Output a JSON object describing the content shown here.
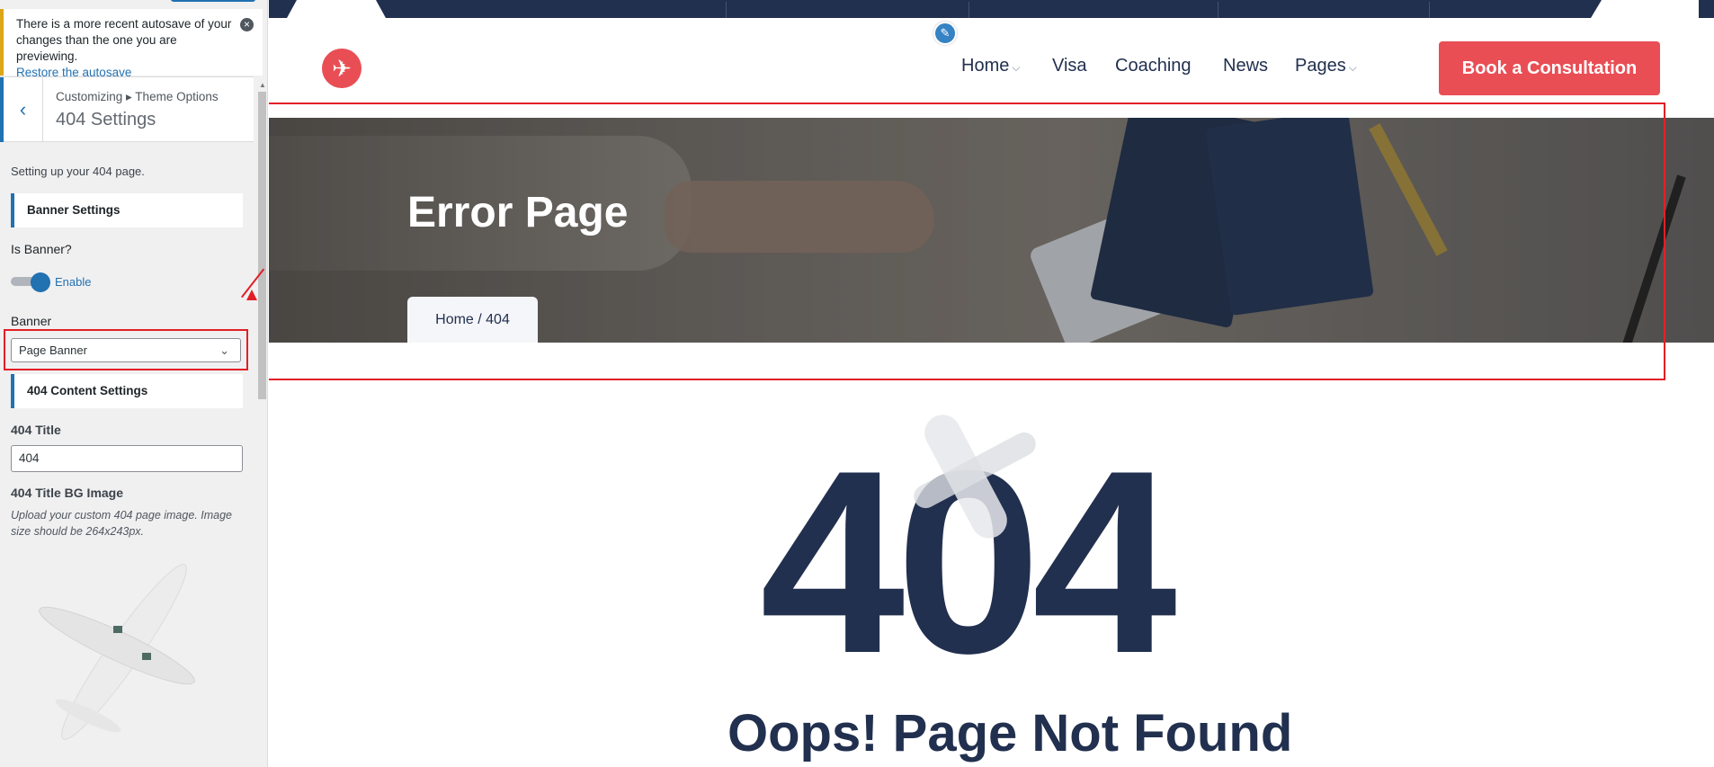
{
  "customizer": {
    "notice": {
      "line1": "There is a more recent autosave of your",
      "line2": "changes than the one you are previewing.",
      "link": "Restore the autosave",
      "close_icon": "close-circle-icon"
    },
    "breadcrumb": "Customizing ▸ Theme Options",
    "section_title": "404 Settings",
    "description": "Setting up your 404 page.",
    "banner_settings": {
      "heading": "Banner Settings",
      "is_banner_label": "Is Banner?",
      "toggle_label": "Enable",
      "toggle_state": "on",
      "banner_label": "Banner",
      "banner_value": "Page Banner"
    },
    "content_settings": {
      "heading": "404 Content Settings",
      "title_label": "404 Title",
      "title_value": "404",
      "bg_image_label": "404 Title BG Image",
      "bg_image_desc": "Upload your custom 404 page image. Image size should be 264x243px."
    }
  },
  "preview": {
    "nav": [
      {
        "label": "Home",
        "has_dropdown": true
      },
      {
        "label": "Visa",
        "has_dropdown": false
      },
      {
        "label": "Coaching",
        "has_dropdown": false
      },
      {
        "label": "News",
        "has_dropdown": false
      },
      {
        "label": "Pages",
        "has_dropdown": true
      }
    ],
    "cta_label": "Book a Consultation",
    "banner_title": "Error Page",
    "banner_breadcrumb": "Home / 404",
    "error_code": "404",
    "error_message": "Oops! Page Not Found"
  },
  "colors": {
    "navy": "#22304f",
    "accent_red": "#e94e55",
    "wp_blue": "#2271b1",
    "highlight_red": "#e21f26"
  }
}
